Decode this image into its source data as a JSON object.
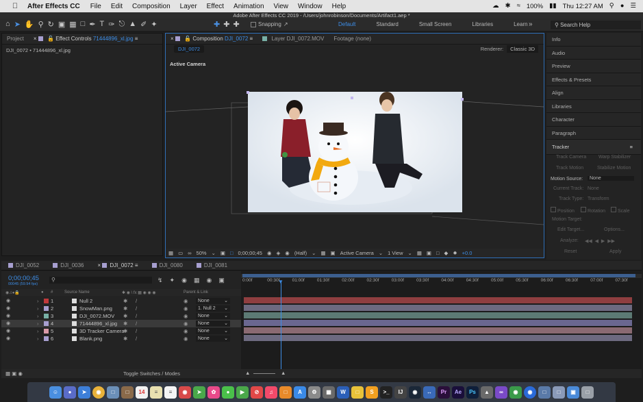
{
  "menubar": {
    "app_name": "After Effects CC",
    "items": [
      "File",
      "Edit",
      "Composition",
      "Layer",
      "Effect",
      "Animation",
      "View",
      "Window",
      "Help"
    ],
    "battery": "100%",
    "clock": "Thu 12:27 AM"
  },
  "window_title": "Adobe After Effects CC 2019 - /Users/johnrobinson/Documents/Artifact1.aep *",
  "toolbar": {
    "snapping_label": "Snapping",
    "workspaces": [
      "Default",
      "Standard",
      "Small Screen",
      "Libraries",
      "Learn"
    ],
    "active_workspace": "Default",
    "search_placeholder": "Search Help"
  },
  "left_panel": {
    "tab_project": "Project",
    "tab_effect_controls_prefix": "Effect Controls",
    "tab_effect_controls_file": "71444896_xl.jpg",
    "subtitle": "DJI_0072 • 71444896_xl.jpg"
  },
  "comp_panel": {
    "tab_comp_prefix": "Composition",
    "tab_comp_name": "DJI_0072",
    "tab_layer": "Layer DJI_0072.MOV",
    "tab_footage": "Footage (none)",
    "subtab": "DJI_0072",
    "renderer_label": "Renderer:",
    "renderer_value": "Classic 3D",
    "active_camera_label": "Active Camera",
    "zoom": "50%",
    "timecode": "0;00;00;45",
    "resolution": "(Half)",
    "camera": "Active Camera",
    "view": "1 View",
    "exposure": "+0.0"
  },
  "right_panel": {
    "items": [
      "Info",
      "Audio",
      "Preview",
      "Effects & Presets",
      "Align",
      "Libraries",
      "Character",
      "Paragraph"
    ],
    "tracker": {
      "title": "Tracker",
      "track_camera": "Track Camera",
      "warp_stabilizer": "Warp Stabilizer",
      "track_motion": "Track Motion",
      "stabilize_motion": "Stabilize Motion",
      "motion_source_label": "Motion Source:",
      "motion_source_value": "None",
      "current_track_label": "Current Track:",
      "current_track_value": "None",
      "track_type_label": "Track Type:",
      "track_type_value": "Transform",
      "position": "Position",
      "rotation": "Rotation",
      "scale": "Scale",
      "motion_target": "Motion Target:",
      "edit_target": "Edit Target...",
      "options": "Options...",
      "analyze": "Analyze:",
      "reset": "Reset",
      "apply": "Apply"
    }
  },
  "timeline": {
    "tabs": [
      "DJI_0052",
      "DJI_0036",
      "DJI_0072",
      "DJI_0080",
      "DJI_0081"
    ],
    "active_tab": "DJI_0072",
    "timecode": "0;00;00;45",
    "fps": "00045 (59.94 fps)",
    "col_source_name": "Source Name",
    "col_parent": "Parent & Link",
    "ruler": [
      "0:00f",
      "00:30f",
      "01:00f",
      "01:30f",
      "02:00f",
      "02:30f",
      "03:00f",
      "03:30f",
      "04:00f",
      "04:30f",
      "05:00f",
      "05:30f",
      "06:00f",
      "06:30f",
      "07:00f",
      "07:30f"
    ],
    "layers": [
      {
        "num": "1",
        "name": "Null 2",
        "parent": "None",
        "label_color": "#c0393b",
        "bar_color": "#8f3e40"
      },
      {
        "num": "2",
        "name": "SnowMan.png",
        "parent": "1. Null 2",
        "label_color": "#a79fd0",
        "bar_color": "#6d6a80"
      },
      {
        "num": "3",
        "name": "DJI_0072.MOV",
        "parent": "None",
        "label_color": "#78b0a6",
        "bar_color": "#5c7a74"
      },
      {
        "num": "4",
        "name": "71444896_xl.jpg",
        "parent": "None",
        "label_color": "#a79fd0",
        "bar_color": "#6a6790"
      },
      {
        "num": "5",
        "name": "3D Tracker Camera",
        "parent": "None",
        "label_color": "#d99aa8",
        "bar_color": "#8a6a72"
      },
      {
        "num": "6",
        "name": "Blank.png",
        "parent": "None",
        "label_color": "#a79fd0",
        "bar_color": "#6d6a80"
      }
    ],
    "footer_label": "Toggle Switches / Modes"
  },
  "colors": {
    "accent": "#3d8ee8",
    "panel": "#232323",
    "menubar": "#e4e4e4"
  }
}
